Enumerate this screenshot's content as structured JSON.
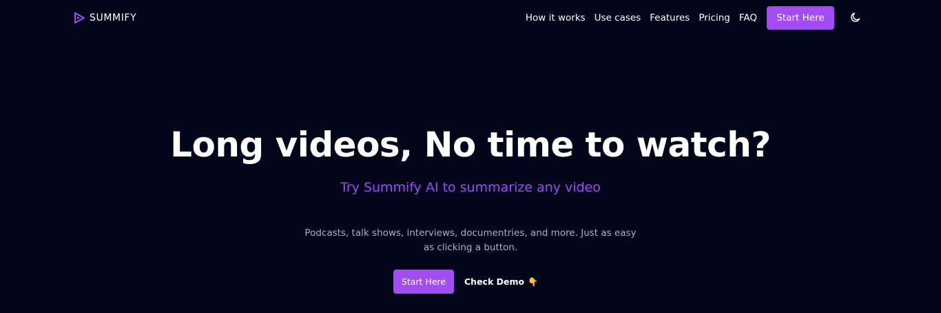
{
  "brand": {
    "name": "SUMMIFY",
    "icon": "play-logo-icon",
    "accent_color": "#a14df3"
  },
  "nav": {
    "links": [
      "How it works",
      "Use cases",
      "Features",
      "Pricing",
      "FAQ"
    ],
    "cta_label": "Start Here",
    "theme_toggle_icon": "moon-icon"
  },
  "hero": {
    "title": "Long videos, No time to watch?",
    "subtitle": "Try Summify AI to summarize any video",
    "description": "Podcasts, talk shows, interviews, documentries, and more. Just as easy as clicking a button.",
    "cta_label": "Start Here",
    "demo_label": "Check Demo",
    "demo_icon": "👇",
    "demo_icon_name": "pointing-down-icon"
  },
  "colors": {
    "background": "#03051a",
    "subtitle": "#8e48e6",
    "description": "#aeb0c4"
  }
}
